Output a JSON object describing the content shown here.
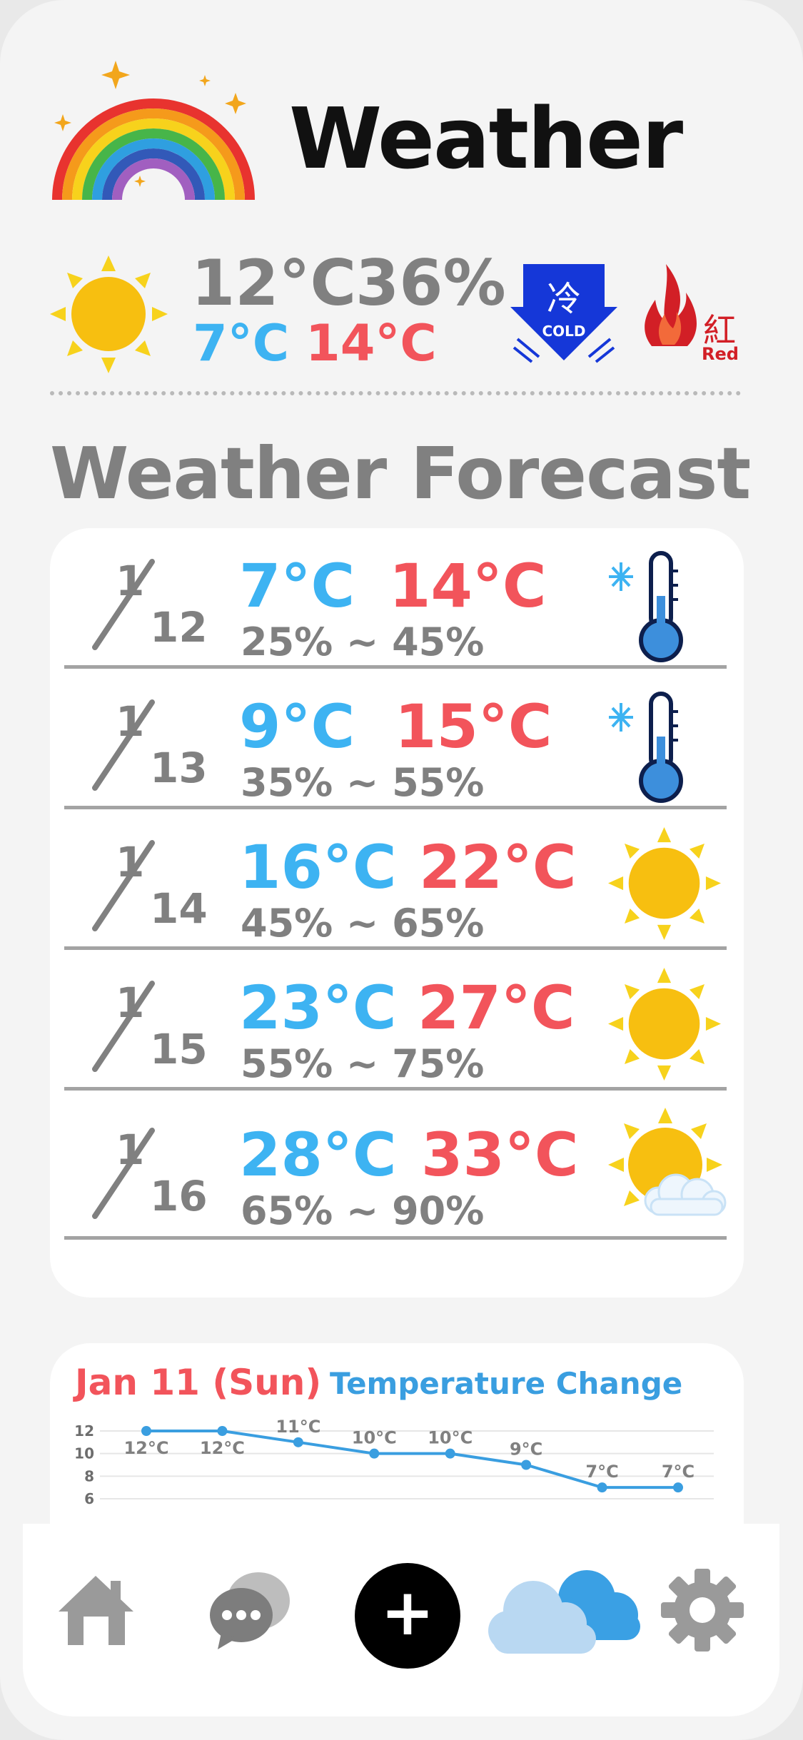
{
  "header": {
    "title": "Weather"
  },
  "current": {
    "temp": "12°C",
    "humidity": "36%",
    "low": "7°C",
    "high": "14°C",
    "cold_badge_kanji": "冷",
    "cold_badge_label": "COLD",
    "red_badge_kanji": "紅",
    "red_badge_label": "Red"
  },
  "forecast": {
    "title": "Weather Forecast",
    "days": [
      {
        "month": "1",
        "day": "12",
        "low": "7°C",
        "high": "14°C",
        "humidity": "25% ~ 45%",
        "icon": "cold-thermometer-icon"
      },
      {
        "month": "1",
        "day": "13",
        "low": "9°C",
        "high": "15°C",
        "humidity": "35% ~ 55%",
        "icon": "cold-thermometer-icon"
      },
      {
        "month": "1",
        "day": "14",
        "low": "16°C",
        "high": "22°C",
        "humidity": "45% ~ 65%",
        "icon": "sun-icon"
      },
      {
        "month": "1",
        "day": "15",
        "low": "23°C",
        "high": "27°C",
        "humidity": "55% ~ 75%",
        "icon": "sun-icon"
      },
      {
        "month": "1",
        "day": "16",
        "low": "28°C",
        "high": "33°C",
        "humidity": "65% ~ 90%",
        "icon": "sun-cloud-icon"
      }
    ]
  },
  "chart_data": {
    "type": "line",
    "title": "Temperature Change",
    "date_label": "Jan 11 (Sun)",
    "x": [
      1,
      2,
      3,
      4,
      5,
      6,
      7,
      8
    ],
    "values": [
      12,
      12,
      11,
      10,
      10,
      9,
      7,
      7
    ],
    "point_labels": [
      "12°C",
      "12°C",
      "11°C",
      "10°C",
      "10°C",
      "9°C",
      "7°C",
      "7°C"
    ],
    "y_ticks": [
      "12",
      "10",
      "8",
      "6"
    ],
    "ylim": [
      6,
      12
    ],
    "grid": true,
    "color": "#3a9ee0"
  },
  "nav": {
    "items": [
      {
        "icon": "home-icon"
      },
      {
        "icon": "chat-icon"
      },
      {
        "icon": "add-icon",
        "glyph": "+"
      },
      {
        "icon": "cloud-icon"
      },
      {
        "icon": "gear-icon"
      }
    ]
  }
}
